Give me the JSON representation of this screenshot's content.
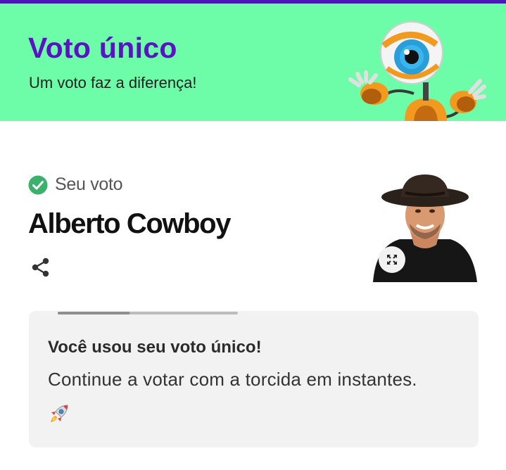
{
  "banner": {
    "title": "Voto único",
    "subtitle": "Um voto faz a diferença!",
    "background_color": "#6dfda8",
    "title_color": "#5a12c4",
    "strip_color": "#4a16b8",
    "mascot_icon": "big-eye-robot-mascot"
  },
  "vote": {
    "status_label": "Seu voto",
    "status_icon": "check-circle-icon",
    "status_color": "#3bb26b",
    "candidate_name": "Alberto Cowboy",
    "share_icon": "share-icon",
    "expand_icon": "expand-icon"
  },
  "notice": {
    "title": "Você usou seu voto único!",
    "text": "Continue a votar com a torcida em instantes.",
    "icon": "rocket-icon",
    "progress": 0.4
  }
}
